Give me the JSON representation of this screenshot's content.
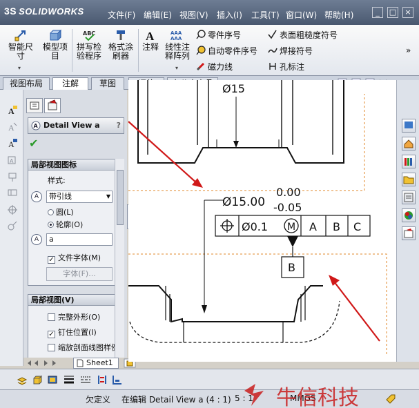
{
  "app": {
    "logo_text": "SOLIDWORKS",
    "logo_mark": "3S"
  },
  "menu": {
    "items": [
      "文件(F)",
      "编辑(E)",
      "视图(V)",
      "插入(I)",
      "工具(T)",
      "窗口(W)",
      "帮助(H)"
    ]
  },
  "window_buttons": [
    "_",
    "□",
    "×"
  ],
  "ribbon": {
    "smart_dim": "智能尺寸",
    "model_items": "模型项目",
    "spell_check": "拼写检验程序",
    "format_painter": "格式涂刷器",
    "note": "注释",
    "linear_pattern": "线性注释阵列",
    "balloon": "零件序号",
    "auto_balloon": "自动零件序号",
    "magnetic_line": "磁力线",
    "surface_finish": "表面粗糙度符号",
    "weld_symbol": "焊接符号",
    "hole_callout": "孔标注",
    "overflow": "»"
  },
  "tabs": [
    {
      "label": "视图布局",
      "active": false
    },
    {
      "label": "注解",
      "active": true
    },
    {
      "label": "草图",
      "active": false
    },
    {
      "label": "评估",
      "active": false
    },
    {
      "label": "办公室产品",
      "active": false
    }
  ],
  "property_manager": {
    "title": "Detail View a",
    "help": "?",
    "ok": "✔",
    "group1": {
      "header": "局部视图图标",
      "style_label": "样式:",
      "style_value": "带引线",
      "radio_circle": "圆(L)",
      "radio_profile": "轮廓(O)",
      "radio_selected": "profile",
      "icon_letter": "A",
      "label_value": "a",
      "doc_font": "文件字体(M)",
      "doc_font_checked": true,
      "font_button": "字体(F)..."
    },
    "group2": {
      "header": "局部视图(V)",
      "full_outline": "完整外形(O)",
      "full_outline_checked": false,
      "pin_position": "钉住位置(I)",
      "pin_position_checked": true,
      "scale_hatch": "缩放剖面线图样例",
      "scale_hatch_checked": false
    }
  },
  "sheet": {
    "tab": "Sheet1"
  },
  "drawing": {
    "dim_top": "Ø15",
    "dim_main": "Ø15.00",
    "tol_upper": "0.00",
    "tol_lower": "-0.05",
    "fcf_value": "Ø0.1",
    "fcf_modifier": "M",
    "datums": [
      "A",
      "B",
      "C"
    ],
    "datum_feature": "B"
  },
  "status": {
    "state": "欠定义",
    "editing": "在编辑 Detail View a (4 : 1)",
    "scale": "5 : 1",
    "units": "MMGS"
  },
  "watermark": {
    "text": "牛信科技"
  },
  "colors": {
    "accent_blue": "#2a5caa",
    "arrow_red": "#d01818",
    "border_orange": "#e0872a",
    "check_green": "#2b9a2b"
  },
  "icons": {
    "left_strip": [
      "note-icon",
      "balloon-icon",
      "surface-finish-icon",
      "weld-icon",
      "datum-icon",
      "gtol-icon",
      "center-mark-icon",
      "hole-callout-icon"
    ],
    "right_tools": [
      "view-palette-icon",
      "home-icon",
      "library-icon",
      "folder-icon",
      "design-library-icon",
      "appearance-icon",
      "custom-properties-icon"
    ],
    "bottom_toolbar": [
      "layer-icon",
      "cube-icon",
      "line-weight-icon",
      "line-style-icon",
      "hide-show-edges-icon",
      "color-display-icon",
      "align-icon"
    ]
  }
}
